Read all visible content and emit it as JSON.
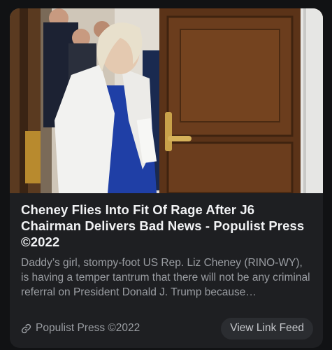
{
  "post": {
    "image_alt": "Woman in white blazer and blue dress walking through a wooden doorway",
    "title": "Cheney Flies Into Fit Of Rage After J6 Chairman Delivers Bad News - Populist Press ©2022",
    "description": "Daddy’s girl, stompy-foot US Rep. Liz Cheney (RINO-WY), is having a temper tantrum that there will not be any criminal referral on President Donald J. Trump because…",
    "source": "Populist Press ©2022",
    "button_label": "View Link Feed"
  },
  "colors": {
    "background": "#111214",
    "card": "#1e1f22",
    "title": "#f1f2f4",
    "muted": "#9a9da2",
    "button": "#2b2d31"
  },
  "icons": {
    "source_icon": "link-icon"
  }
}
